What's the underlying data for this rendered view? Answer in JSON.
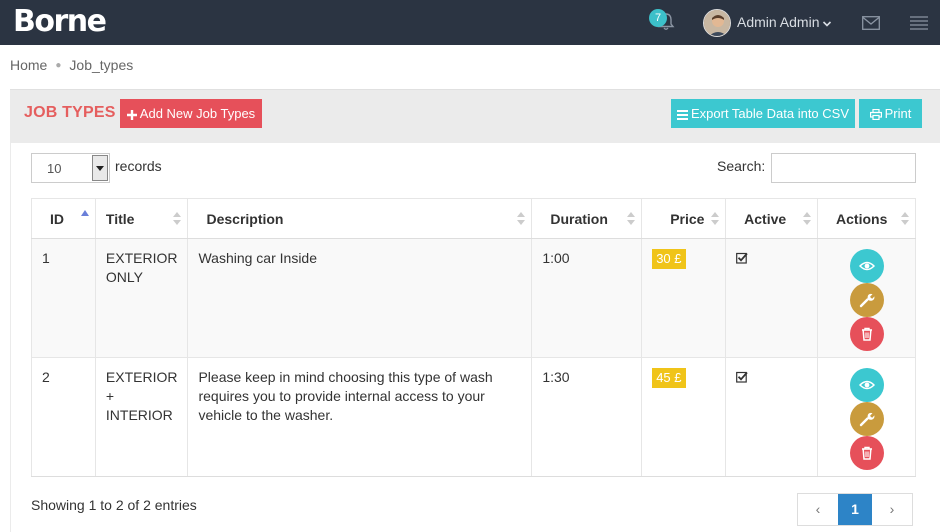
{
  "brand": "Borne",
  "header": {
    "notifications_count": "7",
    "user_name": "Admin Admin"
  },
  "breadcrumb": [
    "Home",
    "Job_types"
  ],
  "panel": {
    "title": "JOB TYPES",
    "add_button": "Add New Job Types",
    "export_button": "Export Table Data into CSV",
    "print_button": "Print"
  },
  "controls": {
    "records_value": "10",
    "records_label": "records",
    "search_label": "Search:",
    "search_value": ""
  },
  "table": {
    "columns": [
      "ID",
      "Title",
      "Description",
      "Duration",
      "Price",
      "Active",
      "Actions"
    ],
    "rows": [
      {
        "id": "1",
        "title_lines": [
          "EXTERIOR",
          "ONLY"
        ],
        "description": "Washing car Inside",
        "duration": "1:00",
        "price": "30 £",
        "active": true
      },
      {
        "id": "2",
        "title_lines": [
          "EXTERIOR",
          "+",
          "INTERIOR"
        ],
        "description": "Please keep in mind choosing this type of wash requires you to provide internal access to your vehicle to the washer.",
        "duration": "1:30",
        "price": "45 £",
        "active": true
      }
    ]
  },
  "footer": {
    "info": "Showing 1 to 2 of 2 entries",
    "prev": "‹",
    "current_page": "1",
    "next": "›"
  },
  "colors": {
    "topbar": "#2b3442",
    "accent_red": "#e6505a",
    "accent_cyan": "#3cc8d0",
    "price_yellow": "#f0c419",
    "edit_gold": "#c99b3d",
    "page_blue": "#2d84c7"
  }
}
